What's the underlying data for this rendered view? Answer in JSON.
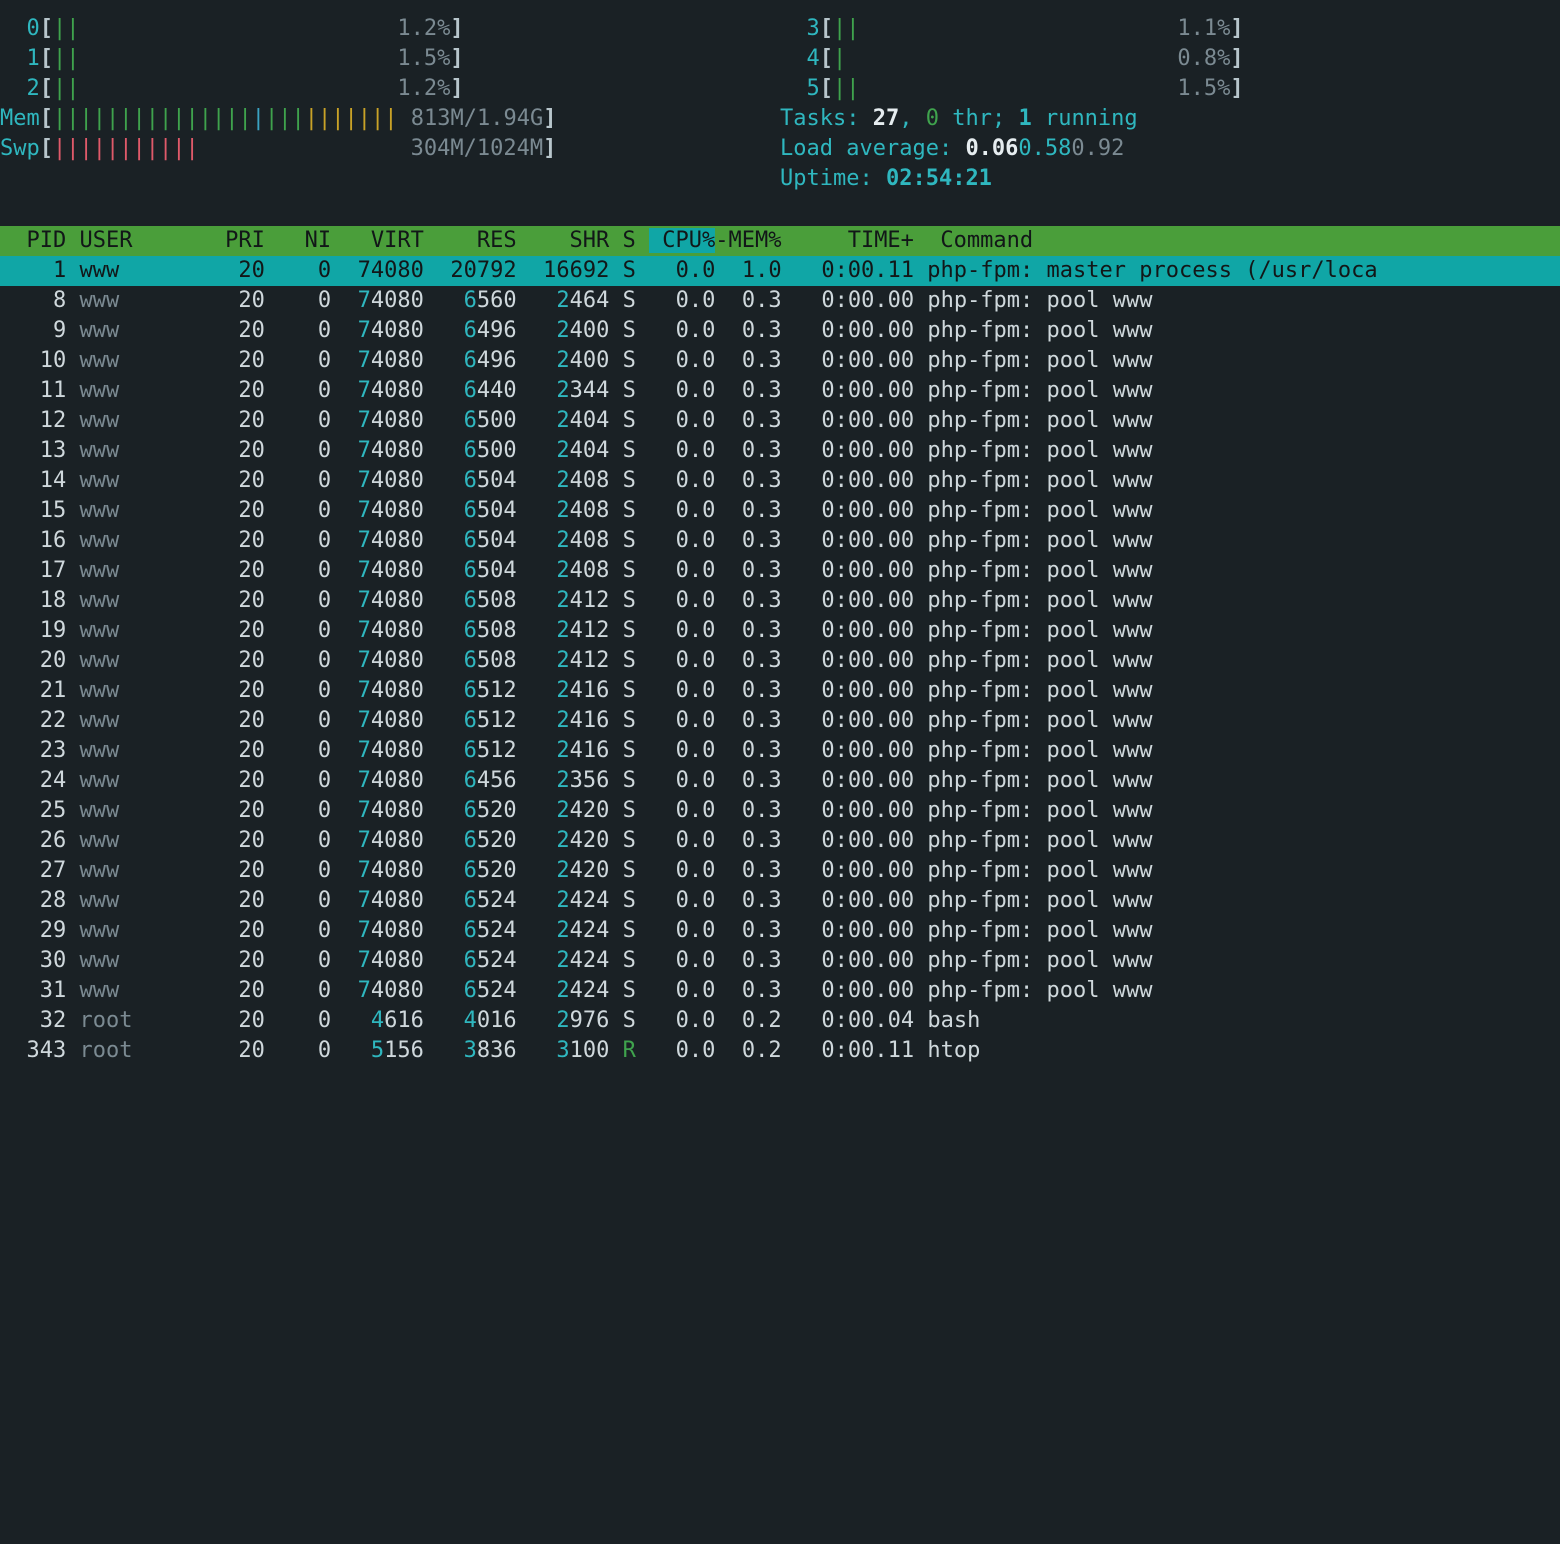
{
  "cpu": [
    {
      "id": "0",
      "bars": "||",
      "pct": "1.2%"
    },
    {
      "id": "1",
      "bars": "||",
      "pct": "1.5%"
    },
    {
      "id": "2",
      "bars": "||",
      "pct": "1.2%"
    },
    {
      "id": "3",
      "bars": "||",
      "pct": "1.1%"
    },
    {
      "id": "4",
      "bars": "|",
      "pct": "0.8%"
    },
    {
      "id": "5",
      "bars": "||",
      "pct": "1.5%"
    }
  ],
  "mem": {
    "label": "Mem",
    "bars": "||||||||||||||||||||||||||",
    "value": "813M/1.94G"
  },
  "swp": {
    "label": "Swp",
    "bars": "|||||||||||",
    "value": "304M/1024M"
  },
  "tasks": {
    "label": "Tasks: ",
    "total": "27",
    "thr": "0",
    "running": "1",
    "suffix_thr": " thr; ",
    "suffix_run": " running"
  },
  "load": {
    "label": "Load average: ",
    "l1": "0.06",
    "l5": "0.58",
    "l15": "0.92"
  },
  "uptime": {
    "label": "Uptime: ",
    "value": "02:54:21"
  },
  "columns": {
    "pid": "PID",
    "user": "USER",
    "pri": "PRI",
    "ni": "NI",
    "virt": "VIRT",
    "res": "RES",
    "shr": "SHR",
    "s": "S",
    "cpu": "CPU%",
    "mem": "-MEM%",
    "time": "TIME+",
    "cmd": "Command"
  },
  "processes": [
    {
      "pid": "1",
      "user": "www",
      "pri": "20",
      "ni": "0",
      "virt": "74080",
      "res": "20792",
      "shr": "16692",
      "s": "S",
      "cpu": "0.0",
      "mem": "1.0",
      "time": "0:00.11",
      "cmd": "php-fpm: master process (/usr/loca",
      "sel": true
    },
    {
      "pid": "8",
      "user": "www",
      "pri": "20",
      "ni": "0",
      "virt": "74080",
      "res": "6560",
      "shr": "2464",
      "s": "S",
      "cpu": "0.0",
      "mem": "0.3",
      "time": "0:00.00",
      "cmd": "php-fpm: pool www"
    },
    {
      "pid": "9",
      "user": "www",
      "pri": "20",
      "ni": "0",
      "virt": "74080",
      "res": "6496",
      "shr": "2400",
      "s": "S",
      "cpu": "0.0",
      "mem": "0.3",
      "time": "0:00.00",
      "cmd": "php-fpm: pool www"
    },
    {
      "pid": "10",
      "user": "www",
      "pri": "20",
      "ni": "0",
      "virt": "74080",
      "res": "6496",
      "shr": "2400",
      "s": "S",
      "cpu": "0.0",
      "mem": "0.3",
      "time": "0:00.00",
      "cmd": "php-fpm: pool www"
    },
    {
      "pid": "11",
      "user": "www",
      "pri": "20",
      "ni": "0",
      "virt": "74080",
      "res": "6440",
      "shr": "2344",
      "s": "S",
      "cpu": "0.0",
      "mem": "0.3",
      "time": "0:00.00",
      "cmd": "php-fpm: pool www"
    },
    {
      "pid": "12",
      "user": "www",
      "pri": "20",
      "ni": "0",
      "virt": "74080",
      "res": "6500",
      "shr": "2404",
      "s": "S",
      "cpu": "0.0",
      "mem": "0.3",
      "time": "0:00.00",
      "cmd": "php-fpm: pool www"
    },
    {
      "pid": "13",
      "user": "www",
      "pri": "20",
      "ni": "0",
      "virt": "74080",
      "res": "6500",
      "shr": "2404",
      "s": "S",
      "cpu": "0.0",
      "mem": "0.3",
      "time": "0:00.00",
      "cmd": "php-fpm: pool www"
    },
    {
      "pid": "14",
      "user": "www",
      "pri": "20",
      "ni": "0",
      "virt": "74080",
      "res": "6504",
      "shr": "2408",
      "s": "S",
      "cpu": "0.0",
      "mem": "0.3",
      "time": "0:00.00",
      "cmd": "php-fpm: pool www"
    },
    {
      "pid": "15",
      "user": "www",
      "pri": "20",
      "ni": "0",
      "virt": "74080",
      "res": "6504",
      "shr": "2408",
      "s": "S",
      "cpu": "0.0",
      "mem": "0.3",
      "time": "0:00.00",
      "cmd": "php-fpm: pool www"
    },
    {
      "pid": "16",
      "user": "www",
      "pri": "20",
      "ni": "0",
      "virt": "74080",
      "res": "6504",
      "shr": "2408",
      "s": "S",
      "cpu": "0.0",
      "mem": "0.3",
      "time": "0:00.00",
      "cmd": "php-fpm: pool www"
    },
    {
      "pid": "17",
      "user": "www",
      "pri": "20",
      "ni": "0",
      "virt": "74080",
      "res": "6504",
      "shr": "2408",
      "s": "S",
      "cpu": "0.0",
      "mem": "0.3",
      "time": "0:00.00",
      "cmd": "php-fpm: pool www"
    },
    {
      "pid": "18",
      "user": "www",
      "pri": "20",
      "ni": "0",
      "virt": "74080",
      "res": "6508",
      "shr": "2412",
      "s": "S",
      "cpu": "0.0",
      "mem": "0.3",
      "time": "0:00.00",
      "cmd": "php-fpm: pool www"
    },
    {
      "pid": "19",
      "user": "www",
      "pri": "20",
      "ni": "0",
      "virt": "74080",
      "res": "6508",
      "shr": "2412",
      "s": "S",
      "cpu": "0.0",
      "mem": "0.3",
      "time": "0:00.00",
      "cmd": "php-fpm: pool www"
    },
    {
      "pid": "20",
      "user": "www",
      "pri": "20",
      "ni": "0",
      "virt": "74080",
      "res": "6508",
      "shr": "2412",
      "s": "S",
      "cpu": "0.0",
      "mem": "0.3",
      "time": "0:00.00",
      "cmd": "php-fpm: pool www"
    },
    {
      "pid": "21",
      "user": "www",
      "pri": "20",
      "ni": "0",
      "virt": "74080",
      "res": "6512",
      "shr": "2416",
      "s": "S",
      "cpu": "0.0",
      "mem": "0.3",
      "time": "0:00.00",
      "cmd": "php-fpm: pool www"
    },
    {
      "pid": "22",
      "user": "www",
      "pri": "20",
      "ni": "0",
      "virt": "74080",
      "res": "6512",
      "shr": "2416",
      "s": "S",
      "cpu": "0.0",
      "mem": "0.3",
      "time": "0:00.00",
      "cmd": "php-fpm: pool www"
    },
    {
      "pid": "23",
      "user": "www",
      "pri": "20",
      "ni": "0",
      "virt": "74080",
      "res": "6512",
      "shr": "2416",
      "s": "S",
      "cpu": "0.0",
      "mem": "0.3",
      "time": "0:00.00",
      "cmd": "php-fpm: pool www"
    },
    {
      "pid": "24",
      "user": "www",
      "pri": "20",
      "ni": "0",
      "virt": "74080",
      "res": "6456",
      "shr": "2356",
      "s": "S",
      "cpu": "0.0",
      "mem": "0.3",
      "time": "0:00.00",
      "cmd": "php-fpm: pool www"
    },
    {
      "pid": "25",
      "user": "www",
      "pri": "20",
      "ni": "0",
      "virt": "74080",
      "res": "6520",
      "shr": "2420",
      "s": "S",
      "cpu": "0.0",
      "mem": "0.3",
      "time": "0:00.00",
      "cmd": "php-fpm: pool www"
    },
    {
      "pid": "26",
      "user": "www",
      "pri": "20",
      "ni": "0",
      "virt": "74080",
      "res": "6520",
      "shr": "2420",
      "s": "S",
      "cpu": "0.0",
      "mem": "0.3",
      "time": "0:00.00",
      "cmd": "php-fpm: pool www"
    },
    {
      "pid": "27",
      "user": "www",
      "pri": "20",
      "ni": "0",
      "virt": "74080",
      "res": "6520",
      "shr": "2420",
      "s": "S",
      "cpu": "0.0",
      "mem": "0.3",
      "time": "0:00.00",
      "cmd": "php-fpm: pool www"
    },
    {
      "pid": "28",
      "user": "www",
      "pri": "20",
      "ni": "0",
      "virt": "74080",
      "res": "6524",
      "shr": "2424",
      "s": "S",
      "cpu": "0.0",
      "mem": "0.3",
      "time": "0:00.00",
      "cmd": "php-fpm: pool www"
    },
    {
      "pid": "29",
      "user": "www",
      "pri": "20",
      "ni": "0",
      "virt": "74080",
      "res": "6524",
      "shr": "2424",
      "s": "S",
      "cpu": "0.0",
      "mem": "0.3",
      "time": "0:00.00",
      "cmd": "php-fpm: pool www"
    },
    {
      "pid": "30",
      "user": "www",
      "pri": "20",
      "ni": "0",
      "virt": "74080",
      "res": "6524",
      "shr": "2424",
      "s": "S",
      "cpu": "0.0",
      "mem": "0.3",
      "time": "0:00.00",
      "cmd": "php-fpm: pool www"
    },
    {
      "pid": "31",
      "user": "www",
      "pri": "20",
      "ni": "0",
      "virt": "74080",
      "res": "6524",
      "shr": "2424",
      "s": "S",
      "cpu": "0.0",
      "mem": "0.3",
      "time": "0:00.00",
      "cmd": "php-fpm: pool www"
    },
    {
      "pid": "32",
      "user": "root",
      "pri": "20",
      "ni": "0",
      "virt": "4616",
      "res": "4016",
      "shr": "2976",
      "s": "S",
      "cpu": "0.0",
      "mem": "0.2",
      "time": "0:00.04",
      "cmd": "bash"
    },
    {
      "pid": "343",
      "user": "root",
      "pri": "20",
      "ni": "0",
      "virt": "5156",
      "res": "3836",
      "shr": "3100",
      "s": "R",
      "cpu": "0.0",
      "mem": "0.2",
      "time": "0:00.11",
      "cmd": "htop"
    }
  ]
}
